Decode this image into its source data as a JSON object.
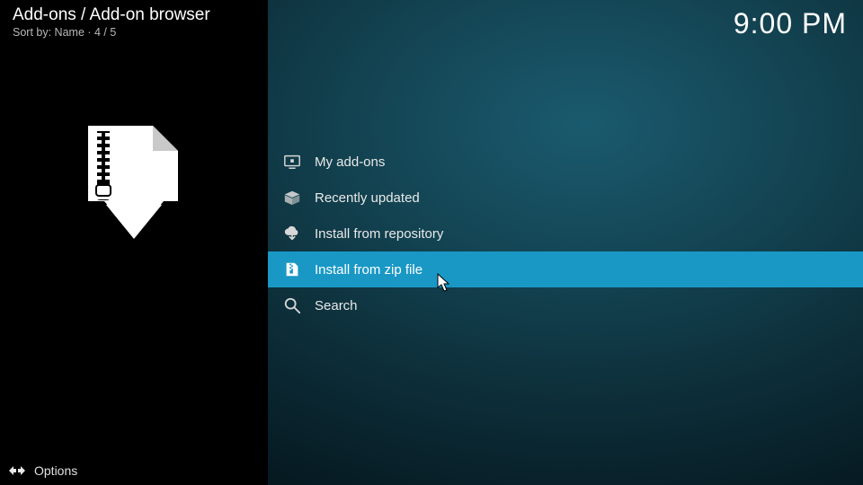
{
  "header": {
    "breadcrumb": "Add-ons / Add-on browser",
    "sort_prefix": "Sort by: ",
    "sort_field": "Name",
    "sort_sep": "  ·  ",
    "position": "4 / 5"
  },
  "clock": "9:00 PM",
  "menu": {
    "items": [
      {
        "icon": "screen-icon",
        "label": "My add-ons",
        "selected": false
      },
      {
        "icon": "open-box-icon",
        "label": "Recently updated",
        "selected": false
      },
      {
        "icon": "cloud-down-icon",
        "label": "Install from repository",
        "selected": false
      },
      {
        "icon": "zip-file-icon",
        "label": "Install from zip file",
        "selected": true
      },
      {
        "icon": "search-icon",
        "label": "Search",
        "selected": false
      }
    ]
  },
  "footer": {
    "label": "Options"
  }
}
